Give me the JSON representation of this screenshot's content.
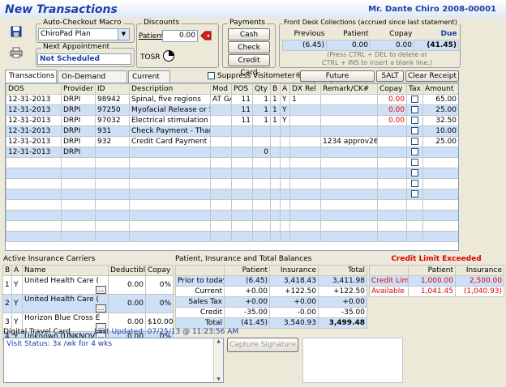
{
  "header": {
    "title": "New Transactions",
    "patient": "Mr. Dante Chiro 2008-00001"
  },
  "checkout_macro": {
    "label": "Auto-Checkout Macro",
    "selected": "ChiroPad Plan"
  },
  "next_appointment": {
    "label": "Next Appointment",
    "value": "Not Scheduled"
  },
  "discounts": {
    "label": "Discounts",
    "patient_label": "Patient",
    "patient_value": "0.00",
    "tosr_label": "TOSR"
  },
  "payments": {
    "label": "Payments",
    "cash": "Cash",
    "check": "Check",
    "credit_card": "Credit Card"
  },
  "front_desk": {
    "label": "Front Desk Collections (accrued since last statement)",
    "headers": [
      "Previous",
      "Patient",
      "Copay",
      "Due"
    ],
    "values": [
      "(6.45)",
      "0.00",
      "0.00",
      "(41.45)"
    ],
    "hint1": "(Press CTRL + DEL to delete or",
    "hint2": "CTRL + INS to insert a blank line.)"
  },
  "tabs": [
    "Transactions",
    "On-Demand Macros",
    "Current Dx"
  ],
  "suppress_label": "Suppress Visitometer®",
  "buttons": {
    "future": "Future Appointments",
    "salt": "SALT",
    "clear": "Clear Receipt",
    "capture": "Capture Signature"
  },
  "transactions": {
    "columns": [
      "DOS",
      "Provider",
      "ID",
      "Description",
      "Mod",
      "POS",
      "Qty",
      "B",
      "A",
      "DX Rel",
      "Remark/CK#",
      "Copay",
      "Tax",
      "Amount"
    ],
    "rows": [
      [
        "12-31-2013",
        "DRPI",
        "98942",
        "Spinal, five regions",
        "AT GA",
        "11",
        "1",
        "1",
        "Y",
        "1",
        "",
        "0.00",
        "",
        "65.00"
      ],
      [
        "12-31-2013",
        "DRPI",
        "97250",
        "Myofacial Release or S",
        "",
        "11",
        "1",
        "1",
        "Y",
        "",
        "",
        "0.00",
        "",
        "25.00"
      ],
      [
        "12-31-2013",
        "DRPI",
        "97032",
        "Electrical stimulation (m",
        "",
        "11",
        "1",
        "1",
        "Y",
        "",
        "",
        "0.00",
        "",
        "32.50"
      ],
      [
        "12-31-2013",
        "DRPI",
        "931",
        "Check Payment - Than",
        "",
        "",
        "",
        "",
        "",
        "",
        "",
        "",
        "",
        "10.00"
      ],
      [
        "12-31-2013",
        "DRPI",
        "932",
        "Credit Card Payment - T",
        "",
        "",
        "",
        "",
        "",
        "",
        "1234 approv263",
        "",
        "",
        "25.00"
      ],
      [
        "12-31-2013",
        "DRPI",
        "",
        "",
        "",
        "",
        "0",
        "",
        "",
        "",
        "",
        "",
        "",
        ""
      ]
    ]
  },
  "insurance": {
    "label": "Active Insurance Carriers",
    "columns": [
      "B",
      "A",
      "Name",
      "Deductible",
      "Copay"
    ],
    "rows": [
      [
        "1",
        "Y",
        "United Health Care (",
        "0.00",
        "0%"
      ],
      [
        "2",
        "Y",
        "United Health Care (",
        "0.00",
        "0%"
      ],
      [
        "3",
        "Y",
        "Horizon Blue Cross E",
        "0.00",
        "$10.00"
      ],
      [
        "4",
        "Y",
        "Unknown (UNKNOV",
        "0.00",
        "0%"
      ]
    ]
  },
  "balances": {
    "label": "Patient, Insurance and Total Balances",
    "columns": [
      "",
      "Patient",
      "Insurance",
      "Total"
    ],
    "rows": [
      [
        "Prior to today",
        "(6.45)",
        "3,418.43",
        "3,411.98"
      ],
      [
        "Current",
        "+0.00",
        "+122.50",
        "+122.50"
      ],
      [
        "Sales Tax",
        "+0.00",
        "+0.00",
        "+0.00"
      ],
      [
        "Credit",
        "-35.00",
        "-0.00",
        "-35.00"
      ],
      [
        "Total",
        "(41.45)",
        "3,540.93",
        "3,499.48"
      ]
    ]
  },
  "credit_limit": {
    "label": "Credit Limit Exceeded",
    "columns": [
      "",
      "Patient",
      "Insurance"
    ],
    "rows": [
      [
        "Credit Limit",
        "1,000.00",
        "2,500.00"
      ],
      [
        "Available",
        "1,041.45",
        "(1,040.93)"
      ]
    ]
  },
  "travel_card": {
    "label": "Digital Travel Card",
    "updated": "Last Updated: 07/25/13 @ 11:23:56 AM",
    "text": "Visit Status:  3x /wk for 4 wks"
  },
  "colors": {
    "title_blue": "#1a3fa8",
    "row_blue": "#cde0f7",
    "alert_red": "#e00000"
  }
}
